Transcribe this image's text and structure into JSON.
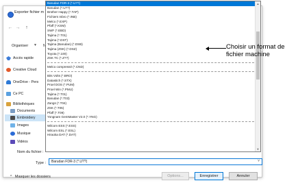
{
  "dialog": {
    "title": "Exporter fichier m",
    "organize_label": "Organiser",
    "toolbar_partial": "N",
    "filename_label": "Nom du fichier :",
    "type_label": "Type :",
    "type_value": "Barudan FDR-3 (*.U??)",
    "hide_folders_label": "Masquer les dossiers",
    "options_label": "Options...",
    "save_label": "Enregistrer",
    "cancel_label": "Annuler"
  },
  "sidebar": {
    "items": [
      {
        "label": "Accès rapide",
        "icon": "pin-icon"
      },
      {
        "label": "Creative Cloud",
        "icon": "creative-cloud-icon"
      },
      {
        "label": "OneDrive - Pers",
        "icon": "onedrive-icon"
      },
      {
        "label": "Ce PC",
        "icon": "computer-icon"
      },
      {
        "label": "Bibliothèques",
        "icon": "library-icon"
      },
      {
        "label": "Documents",
        "icon": "documents-icon"
      },
      {
        "label": "Embroidery",
        "icon": "embroidery-icon"
      },
      {
        "label": "Images",
        "icon": "images-icon"
      },
      {
        "label": "Musique",
        "icon": "music-icon"
      },
      {
        "label": "Vidéos",
        "icon": "videos-icon"
      }
    ]
  },
  "dropdown": {
    "selected_index": 0,
    "group1": [
      "Barudan FDR-3 (*.U??)",
      "Barudan (*.U??)",
      "Brother Happy (*.TAP)",
      "Fichiers Inbro (*.INB)",
      "Melco (*.EXP)",
      "Pfaff (*.KSM)",
      "SWF (*.EBD)",
      "Tajima (*.T01)",
      "Tajima (*.DST)",
      "Tajima (Barudan) (*.DSB)",
      "Tajima (ZSK) (*.DSZ)",
      "Toyota (*.100)",
      "ZSK TC (*.Z??)"
    ],
    "group2": [
      "Melco compressé (*.CND)"
    ],
    "group3": [
      "Bits Volts (*.BRO)",
      "Datastich (*.STX)",
      "Proel DOS (*.PUM)",
      "Proel Win (*.PMU)",
      "Tajima (*.T01)",
      "Barudan (*.T03)",
      "Zangs (*.T04)",
      "ZSK (*.T05)",
      "Pfaff (*.T09)",
      "Yongnam GemMaster V2.0 (*.YNG)"
    ],
    "group4": [
      "Wilcom ESS (*.ESS)",
      "Wilcom ESL (*.ESL)",
      "Hiraoka DAT (*.DAT)"
    ]
  },
  "annotation": {
    "text": "Choisir un format de\nfichier machine"
  },
  "colors": {
    "accent": "#0078d7",
    "selection_bg": "#0078d7",
    "sidebar_selection": "#cce4f7"
  }
}
